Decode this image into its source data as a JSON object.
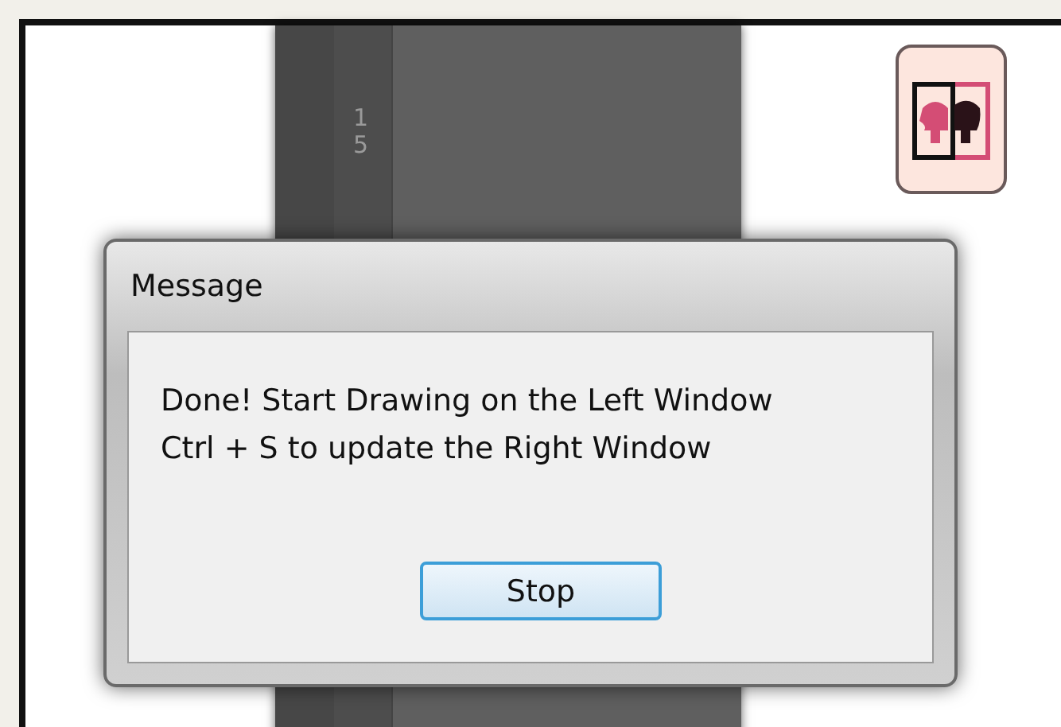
{
  "ruler": {
    "label": "15"
  },
  "dialog": {
    "title": "Message",
    "lines": [
      "Done! Start Drawing on the Left Window",
      "Ctrl + S to update the Right Window"
    ],
    "button": "Stop"
  }
}
